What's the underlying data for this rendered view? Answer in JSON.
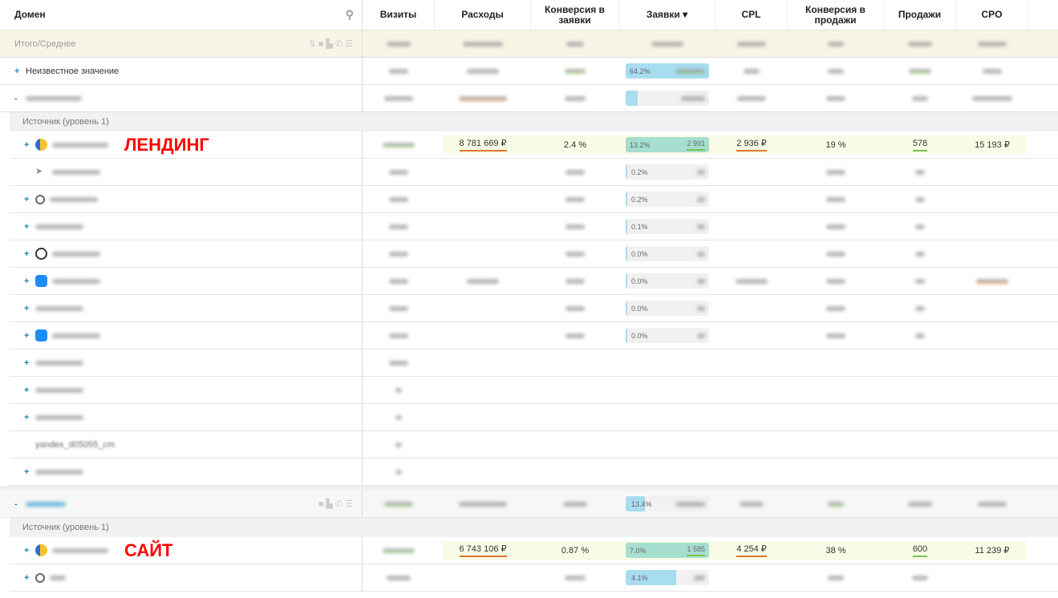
{
  "header": {
    "domain": "Домен",
    "cols": [
      "Визиты",
      "Расходы",
      "Конверсия в заявки",
      "Заявки ▾",
      "CPL",
      "Конверсия в продажи",
      "Продажи",
      "CPO"
    ]
  },
  "total": {
    "label": "Итого/Среднее"
  },
  "unknown": {
    "label": "Неизвестное значение",
    "bar_pct": "64.2%",
    "bar_fill": 64.2
  },
  "group1": {
    "bar_fill": 13
  },
  "source_label": "Источник (уровень 1)",
  "landing": {
    "annotation": "ЛЕНДИНГ",
    "rashody": "8 781 669 ₽",
    "conv": "2.4 %",
    "bar_pct": "13.2%",
    "zayavki": "2 991",
    "cpl": "2 936 ₽",
    "conv_sales": "19 %",
    "sales": "578",
    "cpo": "15 193 ₽"
  },
  "subrows": [
    {
      "logo": "arrow",
      "pct": "0.2%"
    },
    {
      "logo": "search",
      "pct": "0.2%"
    },
    {
      "logo": "none",
      "pct": "0.1%"
    },
    {
      "logo": "globe",
      "pct": "0.0%"
    },
    {
      "logo": "vk",
      "pct": "0.0%",
      "extra": true
    },
    {
      "logo": "none",
      "pct": "0.0%"
    },
    {
      "logo": "vk",
      "pct": "0.0%"
    },
    {
      "logo": "none"
    },
    {
      "logo": "none"
    },
    {
      "logo": "none"
    },
    {
      "logo": "none",
      "text": "yandex_d05055_cm"
    },
    {
      "logo": "none"
    }
  ],
  "group2": {
    "bar_pct": "13.4%",
    "bar_fill": 22
  },
  "site": {
    "annotation": "САЙТ",
    "rashody": "6 743 106 ₽",
    "conv": "0.87 %",
    "bar_pct": "7.0%",
    "zayavki": "1 585",
    "cpl": "4 254 ₽",
    "conv_sales": "38 %",
    "sales": "600",
    "cpo": "11 239 ₽"
  },
  "site_next": {
    "bar_pct": "4.1%",
    "bar_fill": 60
  },
  "colors": {
    "accent": "#1a8ab0",
    "underline_green": "#7cc14a",
    "underline_orange": "#e0782b",
    "highlight": "#f8fbe6",
    "bar_blue": "#a8dcf0",
    "bar_teal": "#a6dfd0"
  }
}
